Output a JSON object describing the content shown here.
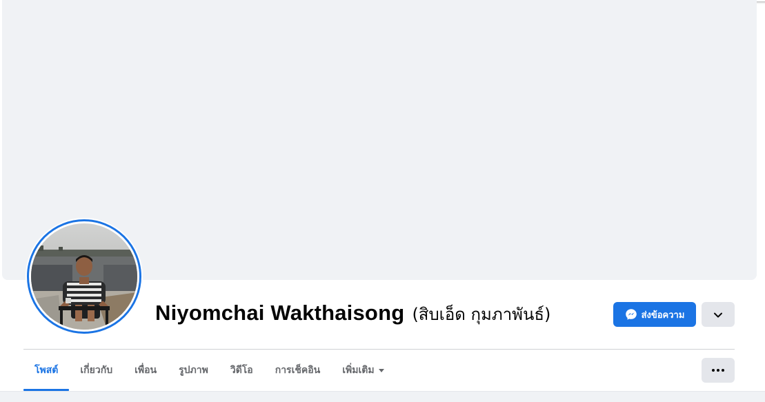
{
  "profile": {
    "name": "Niyomchai Wakthaisong",
    "alternate_name": "(สิบเอ็ด กุมภาพันธ์)"
  },
  "actions": {
    "message_label": "ส่งข้อความ"
  },
  "tabs": [
    {
      "label": "โพสต์",
      "active": true
    },
    {
      "label": "เกี่ยวกับ",
      "active": false
    },
    {
      "label": "เพื่อน",
      "active": false
    },
    {
      "label": "รูปภาพ",
      "active": false
    },
    {
      "label": "วิดีโอ",
      "active": false
    },
    {
      "label": "การเช็คอิน",
      "active": false
    },
    {
      "label": "เพิ่มเติม",
      "active": false,
      "dropdown": true
    }
  ],
  "icons": {
    "message": "messenger-icon",
    "expand": "chevron-down-icon",
    "more": "more-horizontal-icon",
    "tab_dropdown": "caret-down-icon"
  },
  "colors": {
    "accent": "#1b74e4",
    "cover_background": "#f0f2f5",
    "secondary_button": "#e4e6eb",
    "tab_text": "#65676b"
  }
}
